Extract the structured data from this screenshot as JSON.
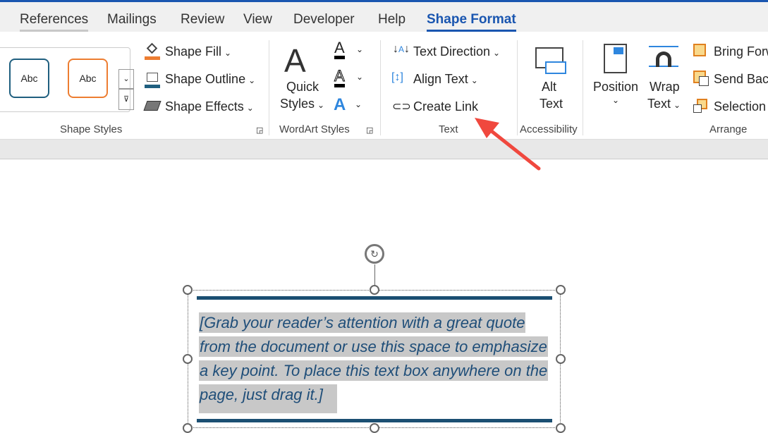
{
  "tabs": [
    {
      "label": "References"
    },
    {
      "label": "Mailings"
    },
    {
      "label": "Review"
    },
    {
      "label": "View"
    },
    {
      "label": "Developer"
    },
    {
      "label": "Help"
    },
    {
      "label": "Shape Format",
      "active": true
    }
  ],
  "shape_styles": {
    "gallery": [
      "Abc",
      "Abc"
    ],
    "fill": "Shape Fill",
    "outline": "Shape Outline",
    "effects": "Shape Effects",
    "group": "Shape Styles"
  },
  "wordart": {
    "quick1": "Quick",
    "quick2": "Styles",
    "group": "WordArt Styles"
  },
  "text": {
    "direction": "Text Direction",
    "align": "Align Text",
    "link": "Create Link",
    "group": "Text"
  },
  "accessibility": {
    "alt1": "Alt",
    "alt2": "Text",
    "group": "Accessibility"
  },
  "arrange": {
    "position": "Position",
    "wrap1": "Wrap",
    "wrap2": "Text",
    "bring": "Bring Forward",
    "send": "Send Backward",
    "selection": "Selection Pane",
    "group": "Arrange"
  },
  "document": {
    "quote_lines": [
      "[Grab your reader’s attention with a great quote",
      "from the document or use this space to emphasize",
      "a key point. To place this text box anywhere on the",
      "page, just drag it.]"
    ]
  },
  "colors": {
    "accent": "#1a56b0",
    "quote": "#1f4e79",
    "annotation_arrow": "#f0483e"
  }
}
